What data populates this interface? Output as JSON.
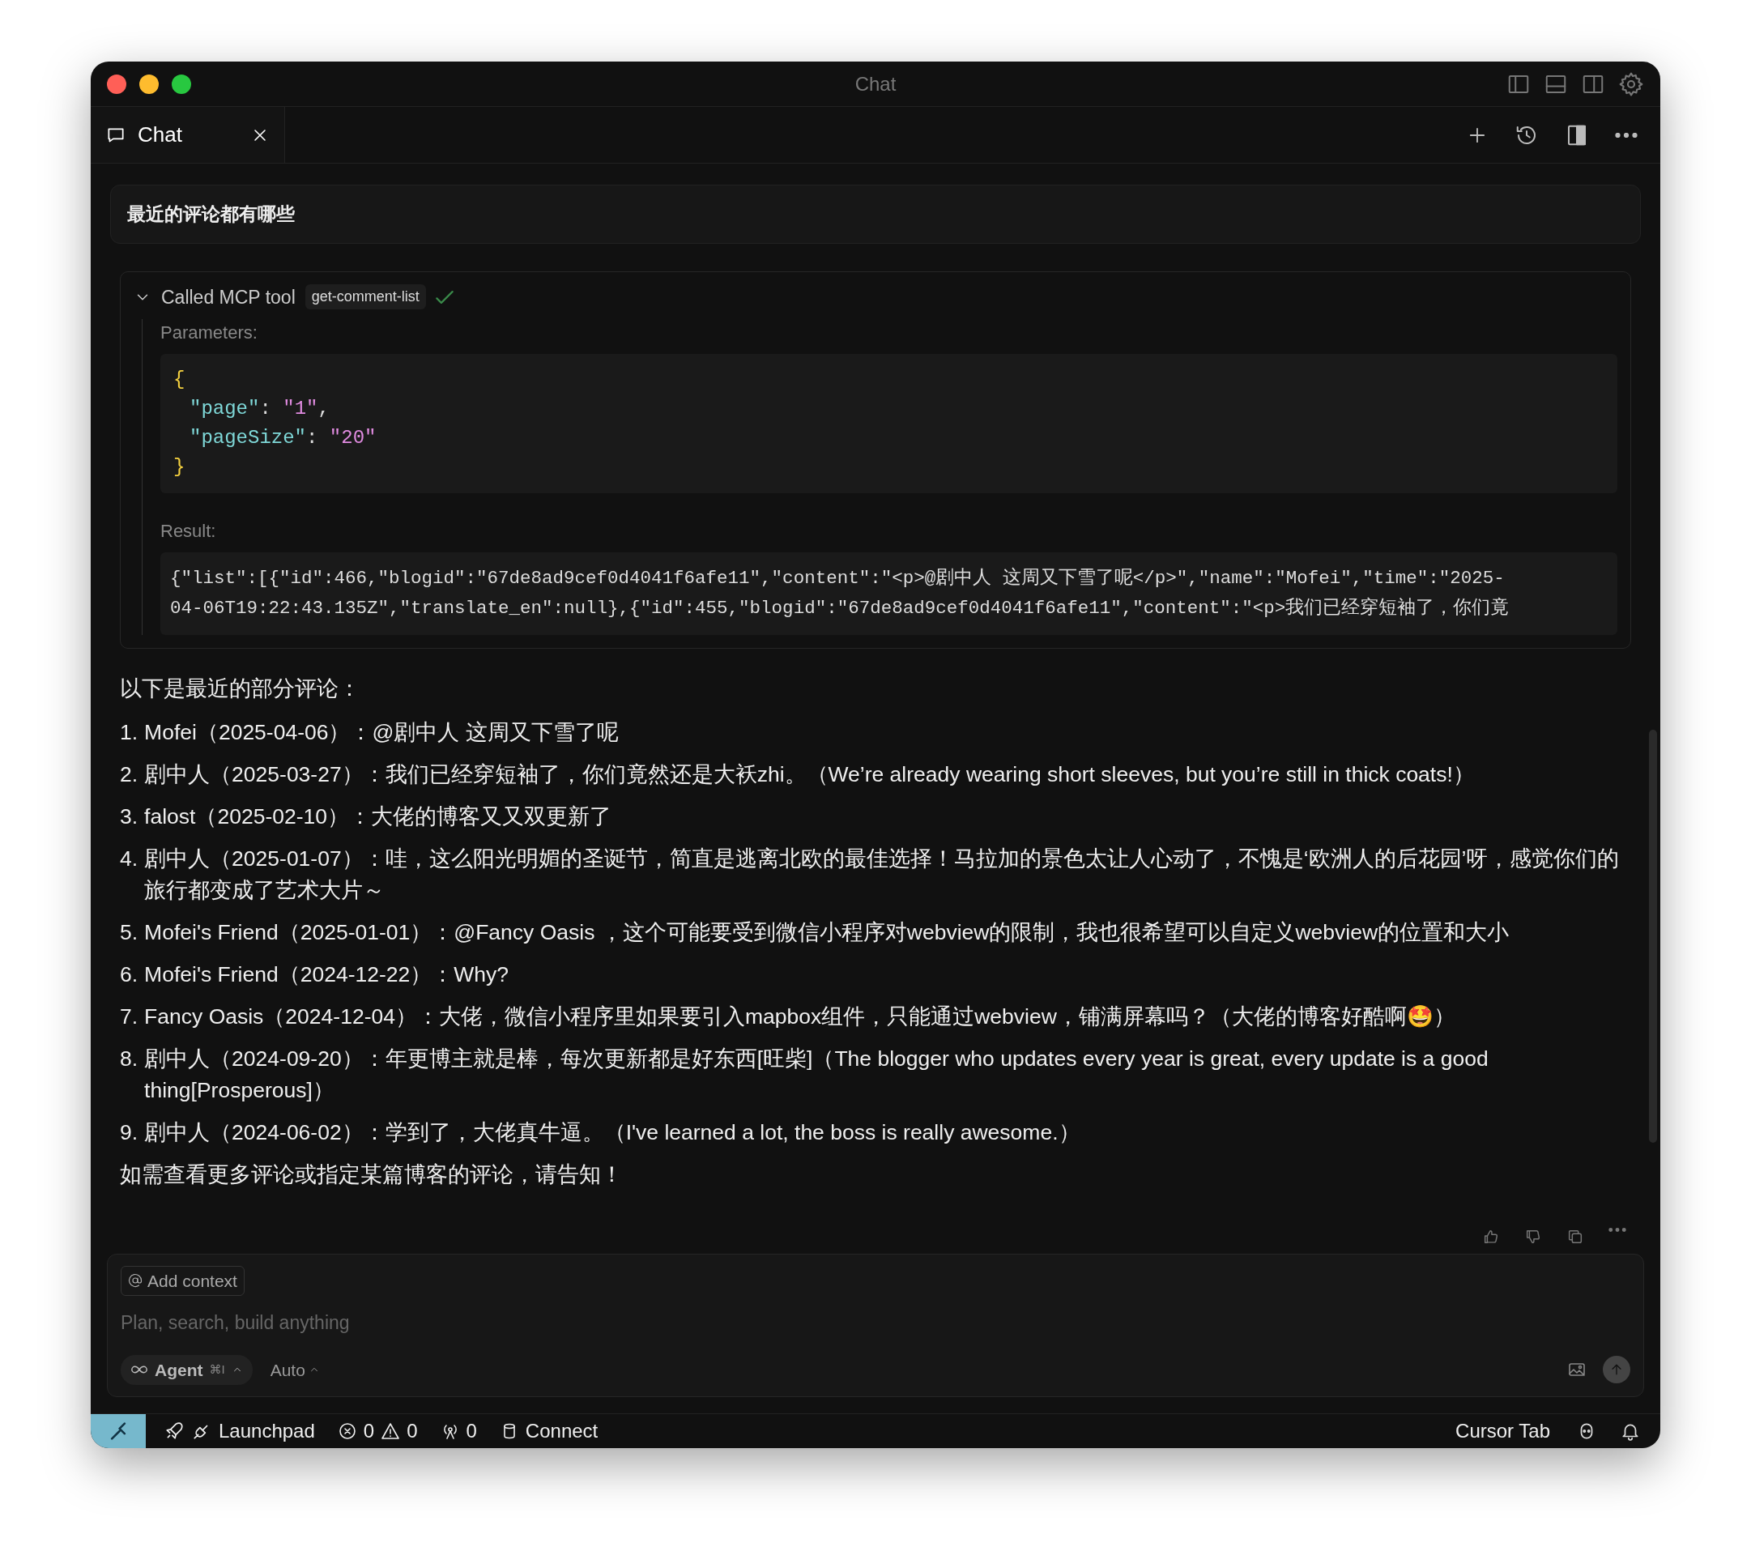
{
  "window": {
    "title": "Chat"
  },
  "tabs": [
    {
      "label": "Chat",
      "selected": true
    }
  ],
  "user_message": "最近的评论都有哪些",
  "tool_call": {
    "label": "Called MCP tool",
    "tool": "get-comment-list",
    "expanded": true,
    "succeeded": true,
    "parameters_label": "Parameters:",
    "parameters": [
      {
        "indented": false,
        "tokens": [
          {
            "kind": "brace",
            "text": "{"
          }
        ]
      },
      {
        "indented": true,
        "tokens": [
          {
            "kind": "key",
            "text": "\"page\""
          },
          {
            "kind": "punct",
            "text": ": "
          },
          {
            "kind": "string",
            "text": "\"1\""
          },
          {
            "kind": "punct",
            "text": ","
          }
        ]
      },
      {
        "indented": true,
        "tokens": [
          {
            "kind": "key",
            "text": "\"pageSize\""
          },
          {
            "kind": "punct",
            "text": ": "
          },
          {
            "kind": "string",
            "text": "\"20\""
          }
        ]
      },
      {
        "indented": false,
        "tokens": [
          {
            "kind": "brace",
            "text": "}"
          }
        ]
      }
    ],
    "result_label": "Result:",
    "result_lines": [
      "{\"list\":[{\"id\":466,\"blogid\":\"67de8ad9cef0d4041f6afe11\",\"content\":\"<p>@剧中人 这周又下雪了呢</p>\",\"name\":\"Mofei\",\"time\":\"2025-",
      "04-06T19:22:43.135Z\",\"translate_en\":null},{\"id\":455,\"blogid\":\"67de8ad9cef0d4041f6afe11\",\"content\":\"<p>我们已经穿短袖了，你们竟"
    ]
  },
  "response": {
    "intro": "以下是最近的部分评论：",
    "items": [
      {
        "number": "1.",
        "text": "Mofei（2025-04-06）：@剧中人 这周又下雪了呢"
      },
      {
        "number": "2.",
        "text": "剧中人（2025-03-27）：我们已经穿短袖了，你们竟然还是大袄zhi。（We’re already wearing short sleeves, but you’re still in thick coats!）"
      },
      {
        "number": "3.",
        "text": "falost（2025-02-10）：大佬的博客又又双更新了"
      },
      {
        "number": "4.",
        "text": "剧中人（2025-01-07）：哇，这么阳光明媚的圣诞节，简直是逃离北欧的最佳选择！马拉加的景色太让人心动了，不愧是‘欧洲人的后花园’呀，感觉你们的旅行都变成了艺术大片～"
      },
      {
        "number": "5.",
        "text": "Mofei's Friend（2025-01-01）：@Fancy Oasis ，这个可能要受到微信小程序对webview的限制，我也很希望可以自定义webview的位置和大小"
      },
      {
        "number": "6.",
        "text": "Mofei's Friend（2024-12-22）：Why?"
      },
      {
        "number": "7.",
        "text": "Fancy Oasis（2024-12-04）：大佬，微信小程序里如果要引入mapbox组件，只能通过webview，铺满屏幕吗？（大佬的博客好酷啊🤩）"
      },
      {
        "number": "8.",
        "text": "剧中人（2024-09-20）：年更博主就是棒，每次更新都是好东西[旺柴]（The blogger who updates every year is great, every update is a good thing[Prosperous]）"
      },
      {
        "number": "9.",
        "text": "剧中人（2024-06-02）：学到了，大佬真牛逼。（I've learned a lot, the boss is really awesome.）"
      }
    ],
    "outro": "如需查看更多评论或指定某篇博客的评论，请告知！"
  },
  "composer": {
    "add_context": "Add context",
    "placeholder": "Plan, search, build anything",
    "mode": "Agent",
    "shortcut": "⌘I",
    "model": "Auto"
  },
  "status_bar": {
    "launchpad": "Launchpad",
    "errors": "0",
    "warnings": "0",
    "ports": "0",
    "connect": "Connect",
    "cursor_tab": "Cursor Tab"
  }
}
